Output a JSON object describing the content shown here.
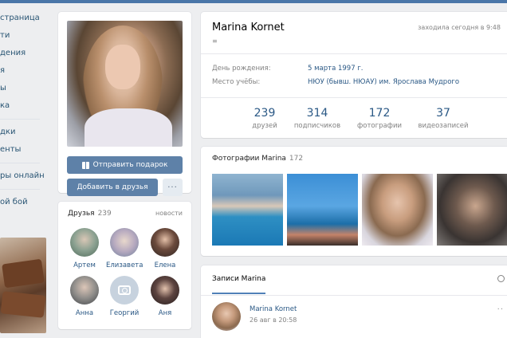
{
  "left_nav": {
    "items": [
      "страница",
      "ти",
      "дения",
      "я",
      "ы",
      "ка",
      "дки",
      "енты",
      "ры онлайн",
      "ой бой"
    ]
  },
  "profile": {
    "name": "Marina Kornet",
    "last_seen": "заходила сегодня в 9:48",
    "status_glyph": "≡",
    "birthday_label": "День рождения:",
    "birthday_value": "5 марта 1997 г.",
    "education_label": "Место учёбы:",
    "education_value": "НЮУ (бывш. НЮАУ) им. Ярослава Мудрого",
    "counters": [
      {
        "value": "239",
        "label": "друзей"
      },
      {
        "value": "314",
        "label": "подписчиков"
      },
      {
        "value": "172",
        "label": "фотографии"
      },
      {
        "value": "37",
        "label": "видеозаписей"
      }
    ]
  },
  "actions": {
    "gift_label": "Отправить подарок",
    "add_friend_label": "Добавить в друзья",
    "more_label": "···"
  },
  "friends": {
    "title": "Друзья",
    "count": "239",
    "news_link": "новости",
    "list": [
      {
        "name": "Артем",
        "color": "#7d8a80"
      },
      {
        "name": "Елизавета",
        "color": "#a9a3b4"
      },
      {
        "name": "Елена",
        "color": "#4d3d35"
      },
      {
        "name": "Анна",
        "color": "#6f7174"
      },
      {
        "name": "Георгий",
        "color": "#c7d2de"
      },
      {
        "name": "Аня",
        "color": "#3e3230"
      }
    ]
  },
  "photos": {
    "title": "Фотографии Marina",
    "count": "172"
  },
  "wall": {
    "tab_label": "Записи Marina",
    "post_author": "Marina Kornet",
    "post_date": "26 авг в 20:58",
    "more_label": "··"
  },
  "colors": {
    "accent": "#5e81a8",
    "link": "#2a5885",
    "header": "#4a76a8",
    "background": "#edeef0"
  }
}
